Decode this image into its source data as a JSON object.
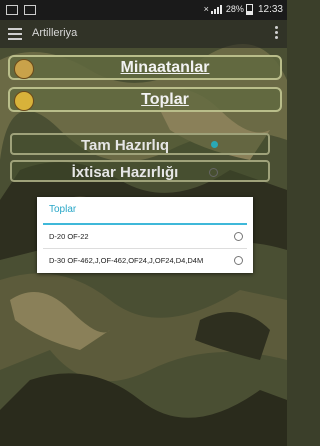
{
  "statusbar": {
    "right_text": "28%",
    "time": "12:33"
  },
  "appbar": {
    "title": "Artilleriya"
  },
  "main": {
    "buttons": [
      {
        "label": "Minaatanlar"
      },
      {
        "label": "Toplar"
      }
    ],
    "options": [
      {
        "label": "Tam Hazırlıq",
        "selected": true
      },
      {
        "label": "İxtisar Hazırlığı",
        "selected": false
      }
    ]
  },
  "dialog": {
    "title": "Toplar",
    "items": [
      {
        "label": "D-20 OF-22"
      },
      {
        "label": "D-30 OF-462,J,OF-462,OF24,J,OF24,D4,D4M"
      }
    ]
  }
}
